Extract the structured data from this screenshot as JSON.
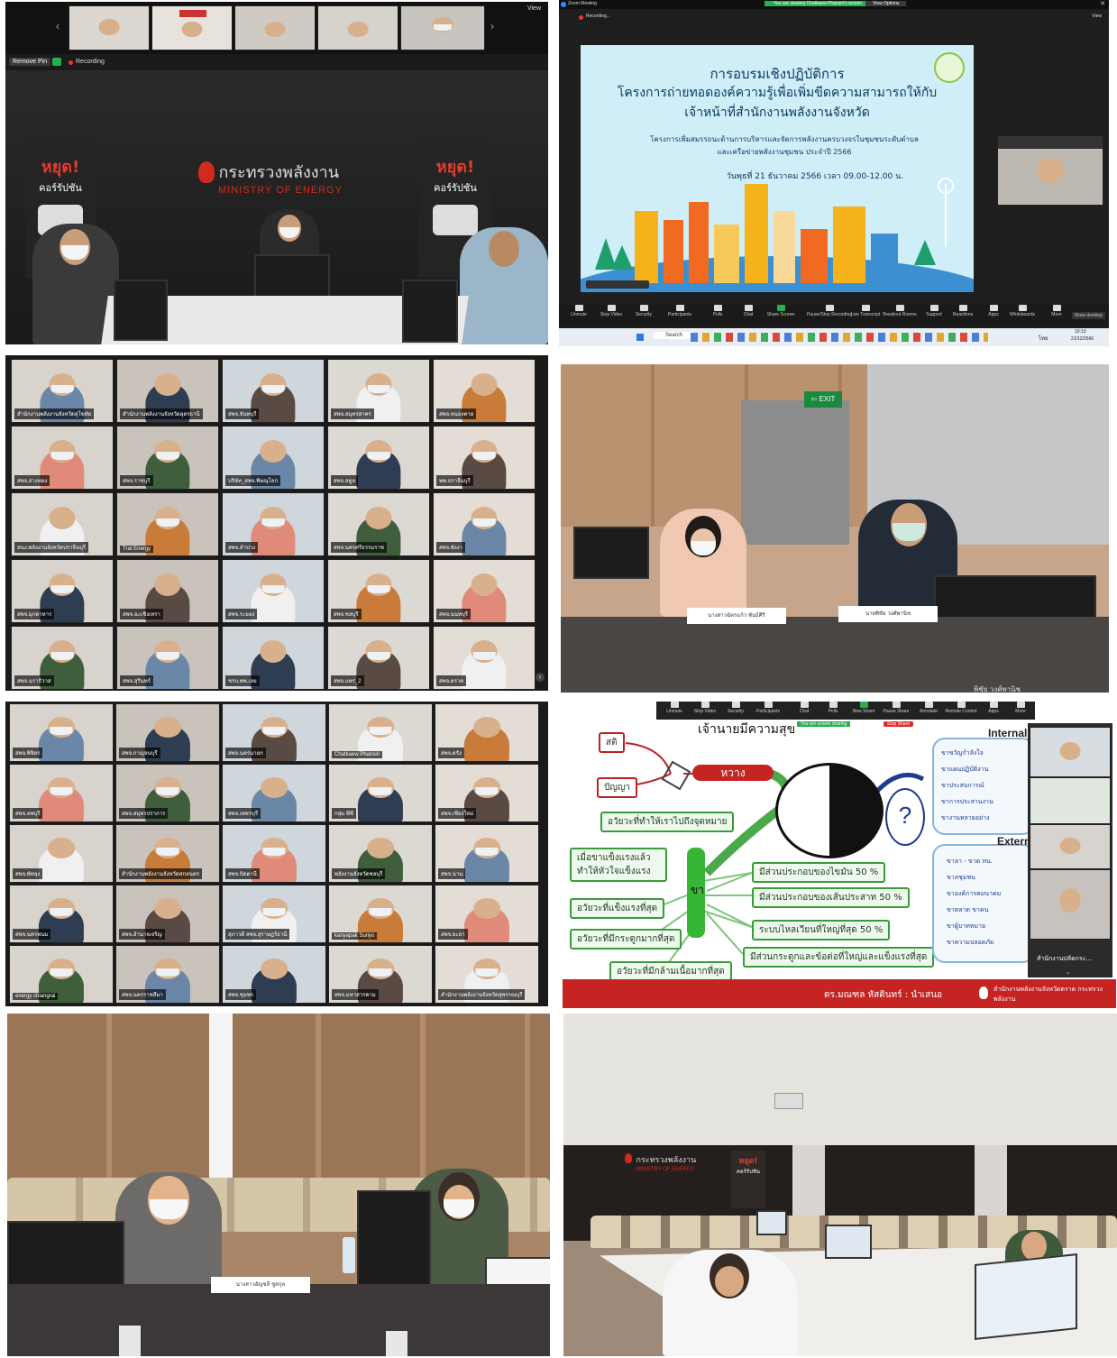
{
  "p1": {
    "view_label": "View",
    "remove_pin": "Remove Pin",
    "recording": "Recording",
    "wall_logo_th": "กระทรวงพลังงาน",
    "wall_logo_en": "MINISTRY OF ENERGY",
    "banner_stop": "หยุด!",
    "banner_corrupt": "คอร์รัปชัน"
  },
  "p2": {
    "window_title": "Zoom Meeting",
    "viewing_banner": "You are viewing Chatkaew Phansiri's screen",
    "view_options": "View Options",
    "view_label": "View",
    "recording": "Recording...",
    "slide_title_1": "การอบรมเชิงปฏิบัติการ",
    "slide_title_2": "โครงการถ่ายทอดองค์ความรู้เพื่อเพิ่มขีดความสามารถให้กับ",
    "slide_title_3": "เจ้าหน้าที่สำนักงานพลังงานจังหวัด",
    "slide_sub_1": "โครงการเพิ่มสมรรถนะด้านการบริหารและจัดการพลังงานครบวงจรในชุมชนระดับตำบล",
    "slide_sub_2": "และเครือข่ายพลังงานชุมชน ประจำปี 2566",
    "slide_date": "วันพุธที่ 21 ธันวาคม 2566 เวลา 09.00-12.00 น.",
    "toolbar": [
      "Unmute",
      "Stop Video",
      "Security",
      "Participants",
      "Polls",
      "Chat",
      "Share Screen",
      "Pause/Stop Recording",
      "Live Transcript",
      "Breakout Rooms",
      "Support",
      "Reactions",
      "Apps",
      "Whiteboards",
      "More"
    ],
    "show_desktop": "Show desktop",
    "taskbar_search": "Search",
    "clock_time": "10:13",
    "clock_date": "21/12/2566",
    "tray_lang": "ไทย"
  },
  "p3": {
    "labels": [
      "สำนักงานพลังงานจังหวัดสุโขทัย",
      "สำนักงานพลังงานจังหวัดอุดรธานี",
      "สพจ.จันทบุรี",
      "สพจ.สมุทรสาคร",
      "สพจ.หนองคาย",
      "สพจ.อ่างทอง",
      "สพจ.ราชบุรี",
      "บริษัท_สพจ.พิษณุโลก",
      "สพจ.สตูล",
      "พพ.ปราจีนบุรี",
      "สนง.พลังงานจังหวัดปราจีนบุรี",
      "Trat Energy",
      "สพจ.ลำปาง",
      "สพจ.นครศรีธรรมราช",
      "สพจ.พังงา",
      "สพจ.มุกดาหาร",
      "สพจ.ฉะเชิงเทรา",
      "สพจ.ระยอง",
      "สพจ.ชลบุรี",
      "สพจ.นนทบุรี",
      "สพจ.นราธิวาส",
      "สพจ.สุรินทร์",
      "ชรบ.พพ.เลย",
      "สพจ.แพร่_2",
      "สพจ.ตราด"
    ]
  },
  "p4": {
    "nameplate_1": "นางสาวฉัตรแก้ว พันธ์ศิริ",
    "nameplate_2": "นายพิชัย วงศ์พานิช",
    "sign_text": "EXIT",
    "bottom_caption": "พิชัย วงศ์พานิช"
  },
  "p5": {
    "labels": [
      "สพจ.พิจิตร",
      "สพจ.กาญจนบุรี",
      "สพจ.นครนายก",
      "Chatkaew Phansiri",
      "สพจ.ตรัง",
      "สพจ.ลพบุรี",
      "สพจ.สมุทรปราการ",
      "สพจ.เพชรบุรี",
      "กลุ่ม พีซี",
      "สพจ.เชียงใหม่",
      "สพจ.พัทลุง",
      "สำนักงานพลังงานจังหวัดสกลนคร",
      "สพจ.ปัตตานี",
      "พลังงานจังหวัดชลบุรี",
      "สพจ.น่าน",
      "สพจ.นครพนม",
      "สพจ.อำนาจเจริญ",
      "สุภาวดี สพจ.สุราษฎร์ธานี",
      "kanyapak Suriyo",
      "สพจ.ยะลา",
      "energy chiangrai",
      "สพจ.นครราชสีมา",
      "สพจ.ชุมพร",
      "สพจ.มหาสารคาม",
      "สำนักงานพลังงานจังหวัดสุพรรณบุรี"
    ]
  },
  "p6": {
    "header": "เจ้านายมีความสุข",
    "sharing_banner": "You are screen sharing",
    "stop_share": "Stop Share",
    "toolbar": [
      "Unmute",
      "Stop Video",
      "Security",
      "Participants",
      "Chat",
      "Polls",
      "New Share",
      "Pause Share",
      "Annotate",
      "Remote Control",
      "Apps",
      "More"
    ],
    "node_sati": "สติ",
    "node_panya": "ปัญญา",
    "node_hwang": "หวาง",
    "node_kha": "ขา",
    "left_items": [
      "อวัยวะที่ทำให้เราไปถึงจุดหมาย",
      "เมื่อขาแข็งแรงแล้ว ทำให้หัวใจแข็งแรง",
      "อวัยวะที่แข็งแรงที่สุด",
      "อวัยวะที่มีกระดูกมากที่สุด",
      "อวัยวะที่มีกล้ามเนื้อมากที่สุด"
    ],
    "right_items": [
      "มีส่วนประกอบของไขมัน 50 %",
      "มีส่วนประกอบของเส้นประสาท 50 %",
      "ระบบไหลเวียนที่ใหญ่ที่สุด 50 %",
      "มีส่วนกระดูกและข้อต่อที่ใหญ่และแข็งแรงที่สุด"
    ],
    "internal_title": "Internal",
    "internal_items": [
      "ขาขวัญกำลังใจ",
      "ขาแผนปฏิบัติงาน",
      "ขาประสบการณ์",
      "ขาการประสานงาน",
      "ขางานหลายอย่าง"
    ],
    "external_title": "External",
    "external_items": [
      "ขาลา - ขาด หน.",
      "ขาลชุมชน",
      "ขาองค์การคมนาคม",
      "ขาตลาด ขาคน",
      "ขาผู้บาทหมาย",
      "ขาความปลอดภัย"
    ],
    "presenter": "ดร.มณฑล หัสดินทร์ : นำเสนอ",
    "footer_org": "สำนักงานพลังงานจังหวัดตราด กระทรวงพลังงาน",
    "side_label": "สำนักงานปลัดกระ..."
  },
  "p7": {
    "nameplate": "นางสาวอัญชลี ชูสกุล"
  },
  "p8": {
    "wall_logo_th": "กระทรวงพลังงาน",
    "wall_logo_en": "MINISTRY OF ENERGY",
    "banner_stop": "หยุด!",
    "banner_corrupt": "คอร์รัปชัน"
  },
  "colors": {
    "zoom_dark": "#1b1b1b",
    "zoom_green": "#23b14d",
    "ministry_red": "#d12a1f",
    "slide_blue": "#cfeef8",
    "mindmap_green": "#3a9b3a"
  }
}
